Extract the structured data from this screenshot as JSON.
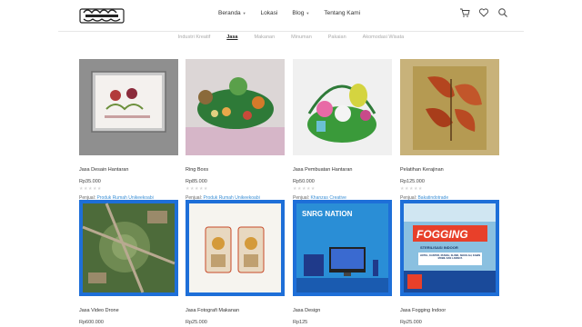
{
  "colors": {
    "accent": "#3a8fd6",
    "text": "#333333",
    "muted": "#aaaaaa"
  },
  "logo_alt": "Kampung Kreatif",
  "nav": [
    {
      "label": "Beranda",
      "has_dropdown": true
    },
    {
      "label": "Lokasi",
      "has_dropdown": false
    },
    {
      "label": "Blog",
      "has_dropdown": true
    },
    {
      "label": "Tentang Kami",
      "has_dropdown": false
    }
  ],
  "header_icons": [
    "cart-icon",
    "heart-icon",
    "search-icon"
  ],
  "categories": [
    {
      "label": "Industri Kreatif",
      "active": false
    },
    {
      "label": "Jasa",
      "active": true
    },
    {
      "label": "Makanan",
      "active": false
    },
    {
      "label": "Minuman",
      "active": false
    },
    {
      "label": "Pakaian",
      "active": false
    },
    {
      "label": "Akomodasi Wisata",
      "active": false
    }
  ],
  "products": [
    {
      "title": "Jasa Desain Hantaran",
      "price": "Rp35.000",
      "seller_label": "Penjual:",
      "seller": "Produk Rumah Unikeekoabi"
    },
    {
      "title": "Ring Boxs",
      "price": "Rp85.000",
      "seller_label": "Penjual:",
      "seller": "Produk Rumah Unikeekoabi"
    },
    {
      "title": "Jasa Pembuatan Hantaran",
      "price": "Rp50.000",
      "seller_label": "Penjual:",
      "seller": "Khanzas Creative"
    },
    {
      "title": "Pelatihan Kerajinan",
      "price": "Rp125.000",
      "seller_label": "Penjual:",
      "seller": "Bakatindotrade"
    },
    {
      "title": "Jasa Video Drone",
      "price": "Rp600.000",
      "seller_label": "",
      "seller": ""
    },
    {
      "title": "Jasa Fotografi Makanan",
      "price": "Rp25.000",
      "seller_label": "",
      "seller": ""
    },
    {
      "title": "Jasa Design",
      "price": "Rp125",
      "seller_label": "",
      "seller": ""
    },
    {
      "title": "Jasa Fogging Indoor",
      "price": "Rp25.000",
      "seller_label": "",
      "seller": ""
    }
  ],
  "image_text": {
    "nation": "SNRG NATION",
    "fogging": "FOGGING",
    "fogging_sub": "STERILISASI INDOOR",
    "fogging_list": "HOTEL, KANTOR, RUMAH, KLINIK, SEKOLAH, KABIN MOBIL DAN LAINNYA"
  }
}
